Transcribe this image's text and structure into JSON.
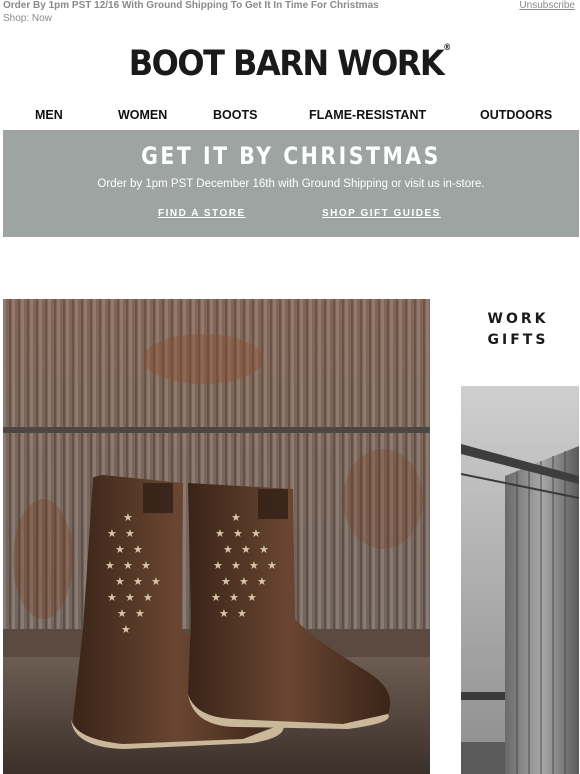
{
  "preheader": {
    "headline": "Order By 1pm PST 12/16 With Ground Shipping To Get It In Time For Christmas",
    "shop_now": "Shop: Now",
    "unsubscribe": "Unsubscribe"
  },
  "logo": {
    "text": "BOOT BARN WORK",
    "mark": "®"
  },
  "nav": {
    "items": [
      {
        "label": "MEN"
      },
      {
        "label": "WOMEN"
      },
      {
        "label": "BOOTS"
      },
      {
        "label": "FLAME-RESISTANT"
      },
      {
        "label": "OUTDOORS"
      }
    ]
  },
  "banner": {
    "title": "GET IT BY CHRISTMAS",
    "subtitle": "Order by 1pm PST December 16th with Ground Shipping or visit us in-store.",
    "link_find_store": "FIND A STORE",
    "link_gift_guides": "SHOP GIFT GUIDES",
    "background": "#9da4a2"
  },
  "side": {
    "title_line1": "WORK",
    "title_line2": "GIFTS"
  },
  "colors": {
    "text_muted": "#8a8a8a",
    "boot_brown": "#4a2e1f",
    "metal_wall": "#7a7470"
  }
}
